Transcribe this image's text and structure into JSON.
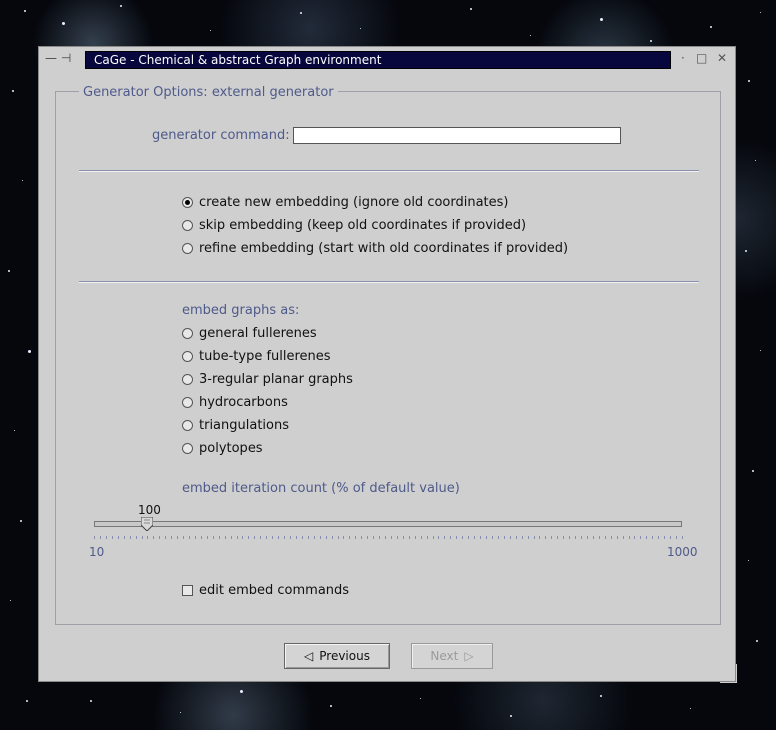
{
  "window": {
    "title": "CaGe - Chemical & abstract Graph environment",
    "left_controls": "— ⊣",
    "right_controls": {
      "minimize": "·",
      "maximize": "□",
      "close": "✕"
    }
  },
  "group": {
    "title": "Generator Options:  external generator"
  },
  "generator": {
    "label": "generator command:",
    "value": "",
    "placeholder": ""
  },
  "embedding_mode": {
    "options": [
      {
        "label": "create new embedding (ignore old coordinates)",
        "selected": true
      },
      {
        "label": "skip embedding (keep old coordinates if provided)",
        "selected": false
      },
      {
        "label": "refine embedding (start with old coordinates if provided)",
        "selected": false
      }
    ]
  },
  "embed_as": {
    "heading": "embed graphs as:",
    "options": [
      {
        "label": "general fullerenes",
        "selected": false
      },
      {
        "label": "tube-type fullerenes",
        "selected": false
      },
      {
        "label": "3-regular planar graphs",
        "selected": false
      },
      {
        "label": "hydrocarbons",
        "selected": false
      },
      {
        "label": "triangulations",
        "selected": false
      },
      {
        "label": "polytopes",
        "selected": false
      }
    ]
  },
  "iteration": {
    "heading": "embed iteration count (% of default value)",
    "value": "100",
    "min": "10",
    "max": "1000"
  },
  "edit_commands": {
    "label": "edit embed commands",
    "checked": false
  },
  "buttons": {
    "previous": "Previous",
    "next": "Next"
  },
  "colors": {
    "titlebar": "#07073d",
    "label_blue": "#4e5a8a",
    "dialog_bg": "#cfcfcf"
  }
}
